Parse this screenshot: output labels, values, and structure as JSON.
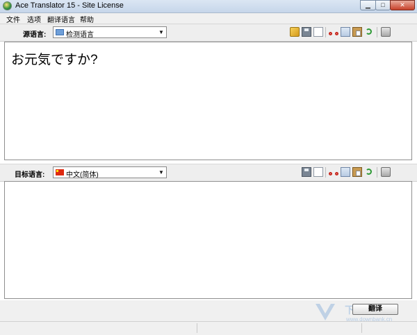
{
  "window": {
    "title": "Ace Translator 15 - Site License",
    "minimize_glyph": "▁",
    "maximize_glyph": "□",
    "close_glyph": "✕"
  },
  "menu": {
    "items": [
      "文件",
      "选项",
      "翻译语言",
      "帮助"
    ]
  },
  "source": {
    "label": "源语言:",
    "language": "检测语言",
    "text": "お元気ですか?"
  },
  "target": {
    "label": "目标语言:",
    "language": "中文(简体)",
    "text": ""
  },
  "dropdown_glyph": "▼",
  "buttons": {
    "translate": "翻译"
  },
  "watermark": {
    "name": "下载银行",
    "url": "www.downbank.cn"
  }
}
